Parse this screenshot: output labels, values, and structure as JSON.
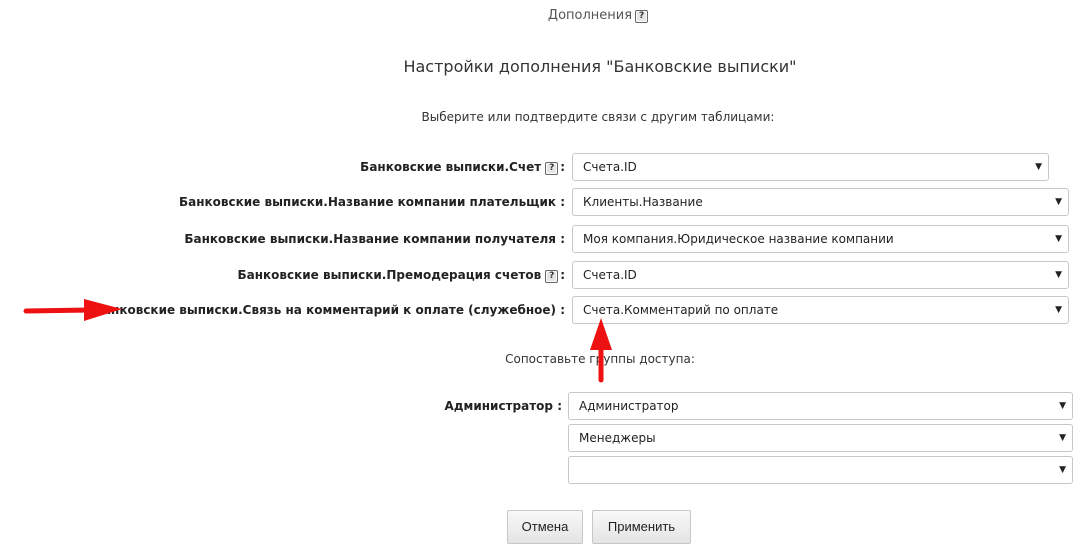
{
  "header": {
    "breadcrumb": "Дополнения",
    "help_glyph": "?",
    "title": "Настройки дополнения \"Банковские выписки\"",
    "subtitle": "Выберите или подтвердите связи с другим таблицами:"
  },
  "links": [
    {
      "label": "Банковские выписки.Счет",
      "has_help": true,
      "value": "Счета.ID"
    },
    {
      "label": "Банковские выписки.Название компании плательщик",
      "has_help": false,
      "value": "Клиенты.Название"
    },
    {
      "label": "Банковские выписки.Название компании получателя",
      "has_help": false,
      "value": "Моя компания.Юридическое название компании"
    },
    {
      "label": "Банковские выписки.Премодерация счетов",
      "has_help": true,
      "value": "Счета.ID"
    },
    {
      "label": "Банковские выписки.Связь на комментарий к оплате (служебное)",
      "has_help": false,
      "value": "Счета.Комментарий по оплате"
    }
  ],
  "colon": ":",
  "access": {
    "title": "Сопоставьте группы доступа:",
    "label": "Администратор",
    "values": [
      "Администратор",
      "Менеджеры",
      ""
    ]
  },
  "buttons": {
    "cancel": "Отмена",
    "apply": "Применить"
  },
  "colors": {
    "annotation_arrow": "#ee1111"
  },
  "icons": {
    "help": "help-icon",
    "dropdown": "chevron-down-icon"
  }
}
